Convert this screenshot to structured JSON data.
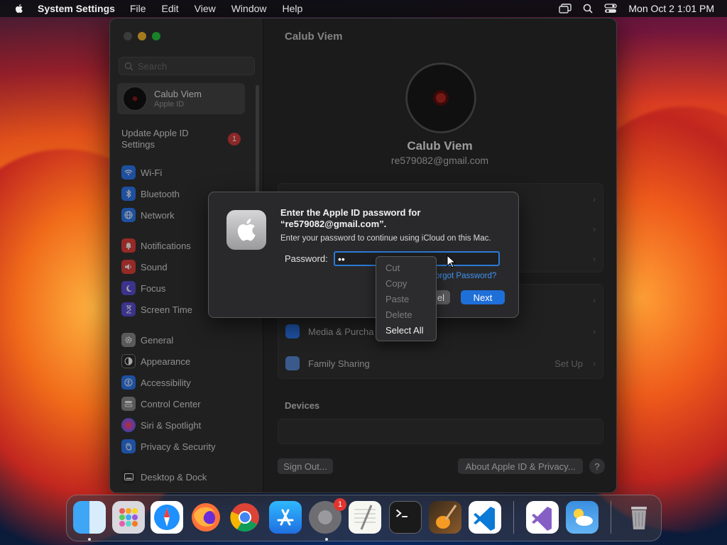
{
  "menubar": {
    "app_name": "System Settings",
    "items": [
      "File",
      "Edit",
      "View",
      "Window",
      "Help"
    ],
    "clock": "Mon Oct 2  1:01 PM"
  },
  "sidebar": {
    "search_placeholder": "Search",
    "profile": {
      "name": "Calub Viem",
      "subtitle": "Apple ID"
    },
    "update": {
      "label": "Update Apple ID Settings",
      "badge": "1"
    },
    "items": [
      {
        "label": "Wi-Fi",
        "icon": "wifi-icon",
        "color": "#2f7cf6"
      },
      {
        "label": "Bluetooth",
        "icon": "bluetooth-icon",
        "color": "#2f7cf6"
      },
      {
        "label": "Network",
        "icon": "globe-icon",
        "color": "#2f7cf6"
      },
      {
        "label": "Notifications",
        "icon": "bell-icon",
        "color": "#e5413b"
      },
      {
        "label": "Sound",
        "icon": "speaker-icon",
        "color": "#e5413b"
      },
      {
        "label": "Focus",
        "icon": "moon-icon",
        "color": "#5b4fd8"
      },
      {
        "label": "Screen Time",
        "icon": "hourglass-icon",
        "color": "#5b4fd8"
      },
      {
        "label": "General",
        "icon": "gear-icon",
        "color": "#8a8a8e"
      },
      {
        "label": "Appearance",
        "icon": "appearance-icon",
        "color": "#2b2b2d"
      },
      {
        "label": "Accessibility",
        "icon": "accessibility-icon",
        "color": "#2f7cf6"
      },
      {
        "label": "Control Center",
        "icon": "control-center-icon",
        "color": "#8a8a8e"
      },
      {
        "label": "Siri & Spotlight",
        "icon": "siri-icon",
        "color": "#c04ad8"
      },
      {
        "label": "Privacy & Security",
        "icon": "hand-icon",
        "color": "#2f7cf6"
      },
      {
        "label": "Desktop & Dock",
        "icon": "dock-icon",
        "color": "#2b2b2d"
      }
    ]
  },
  "main": {
    "title": "Calub Viem",
    "name": "Calub Viem",
    "email": "re579082@gmail.com",
    "media_row": "Media & Purcha",
    "family_row": "Family Sharing",
    "family_action": "Set Up",
    "devices_heading": "Devices",
    "sign_out": "Sign Out...",
    "about": "About Apple ID & Privacy...",
    "help": "?"
  },
  "dialog": {
    "title": "Enter the Apple ID password for “re579082@gmail.com”.",
    "subtitle": "Enter your password to continue using iCloud on this Mac.",
    "password_label": "Password:",
    "password_value": "••",
    "forgot": "orgot Password?",
    "cancel": "el",
    "next": "Next"
  },
  "context_menu": {
    "items": [
      {
        "label": "Cut",
        "enabled": false
      },
      {
        "label": "Copy",
        "enabled": false
      },
      {
        "label": "Paste",
        "enabled": false
      },
      {
        "label": "Delete",
        "enabled": false
      },
      {
        "label": "Select All",
        "enabled": true
      }
    ]
  },
  "dock": {
    "apps": [
      "Finder",
      "Launchpad",
      "Safari",
      "Firefox",
      "Chrome",
      "App Store",
      "System Settings",
      "TextEdit",
      "Terminal",
      "GarageBand",
      "Visual Studio Code",
      "Visual Studio",
      "Weather",
      "Trash"
    ],
    "settings_badge": "1"
  }
}
